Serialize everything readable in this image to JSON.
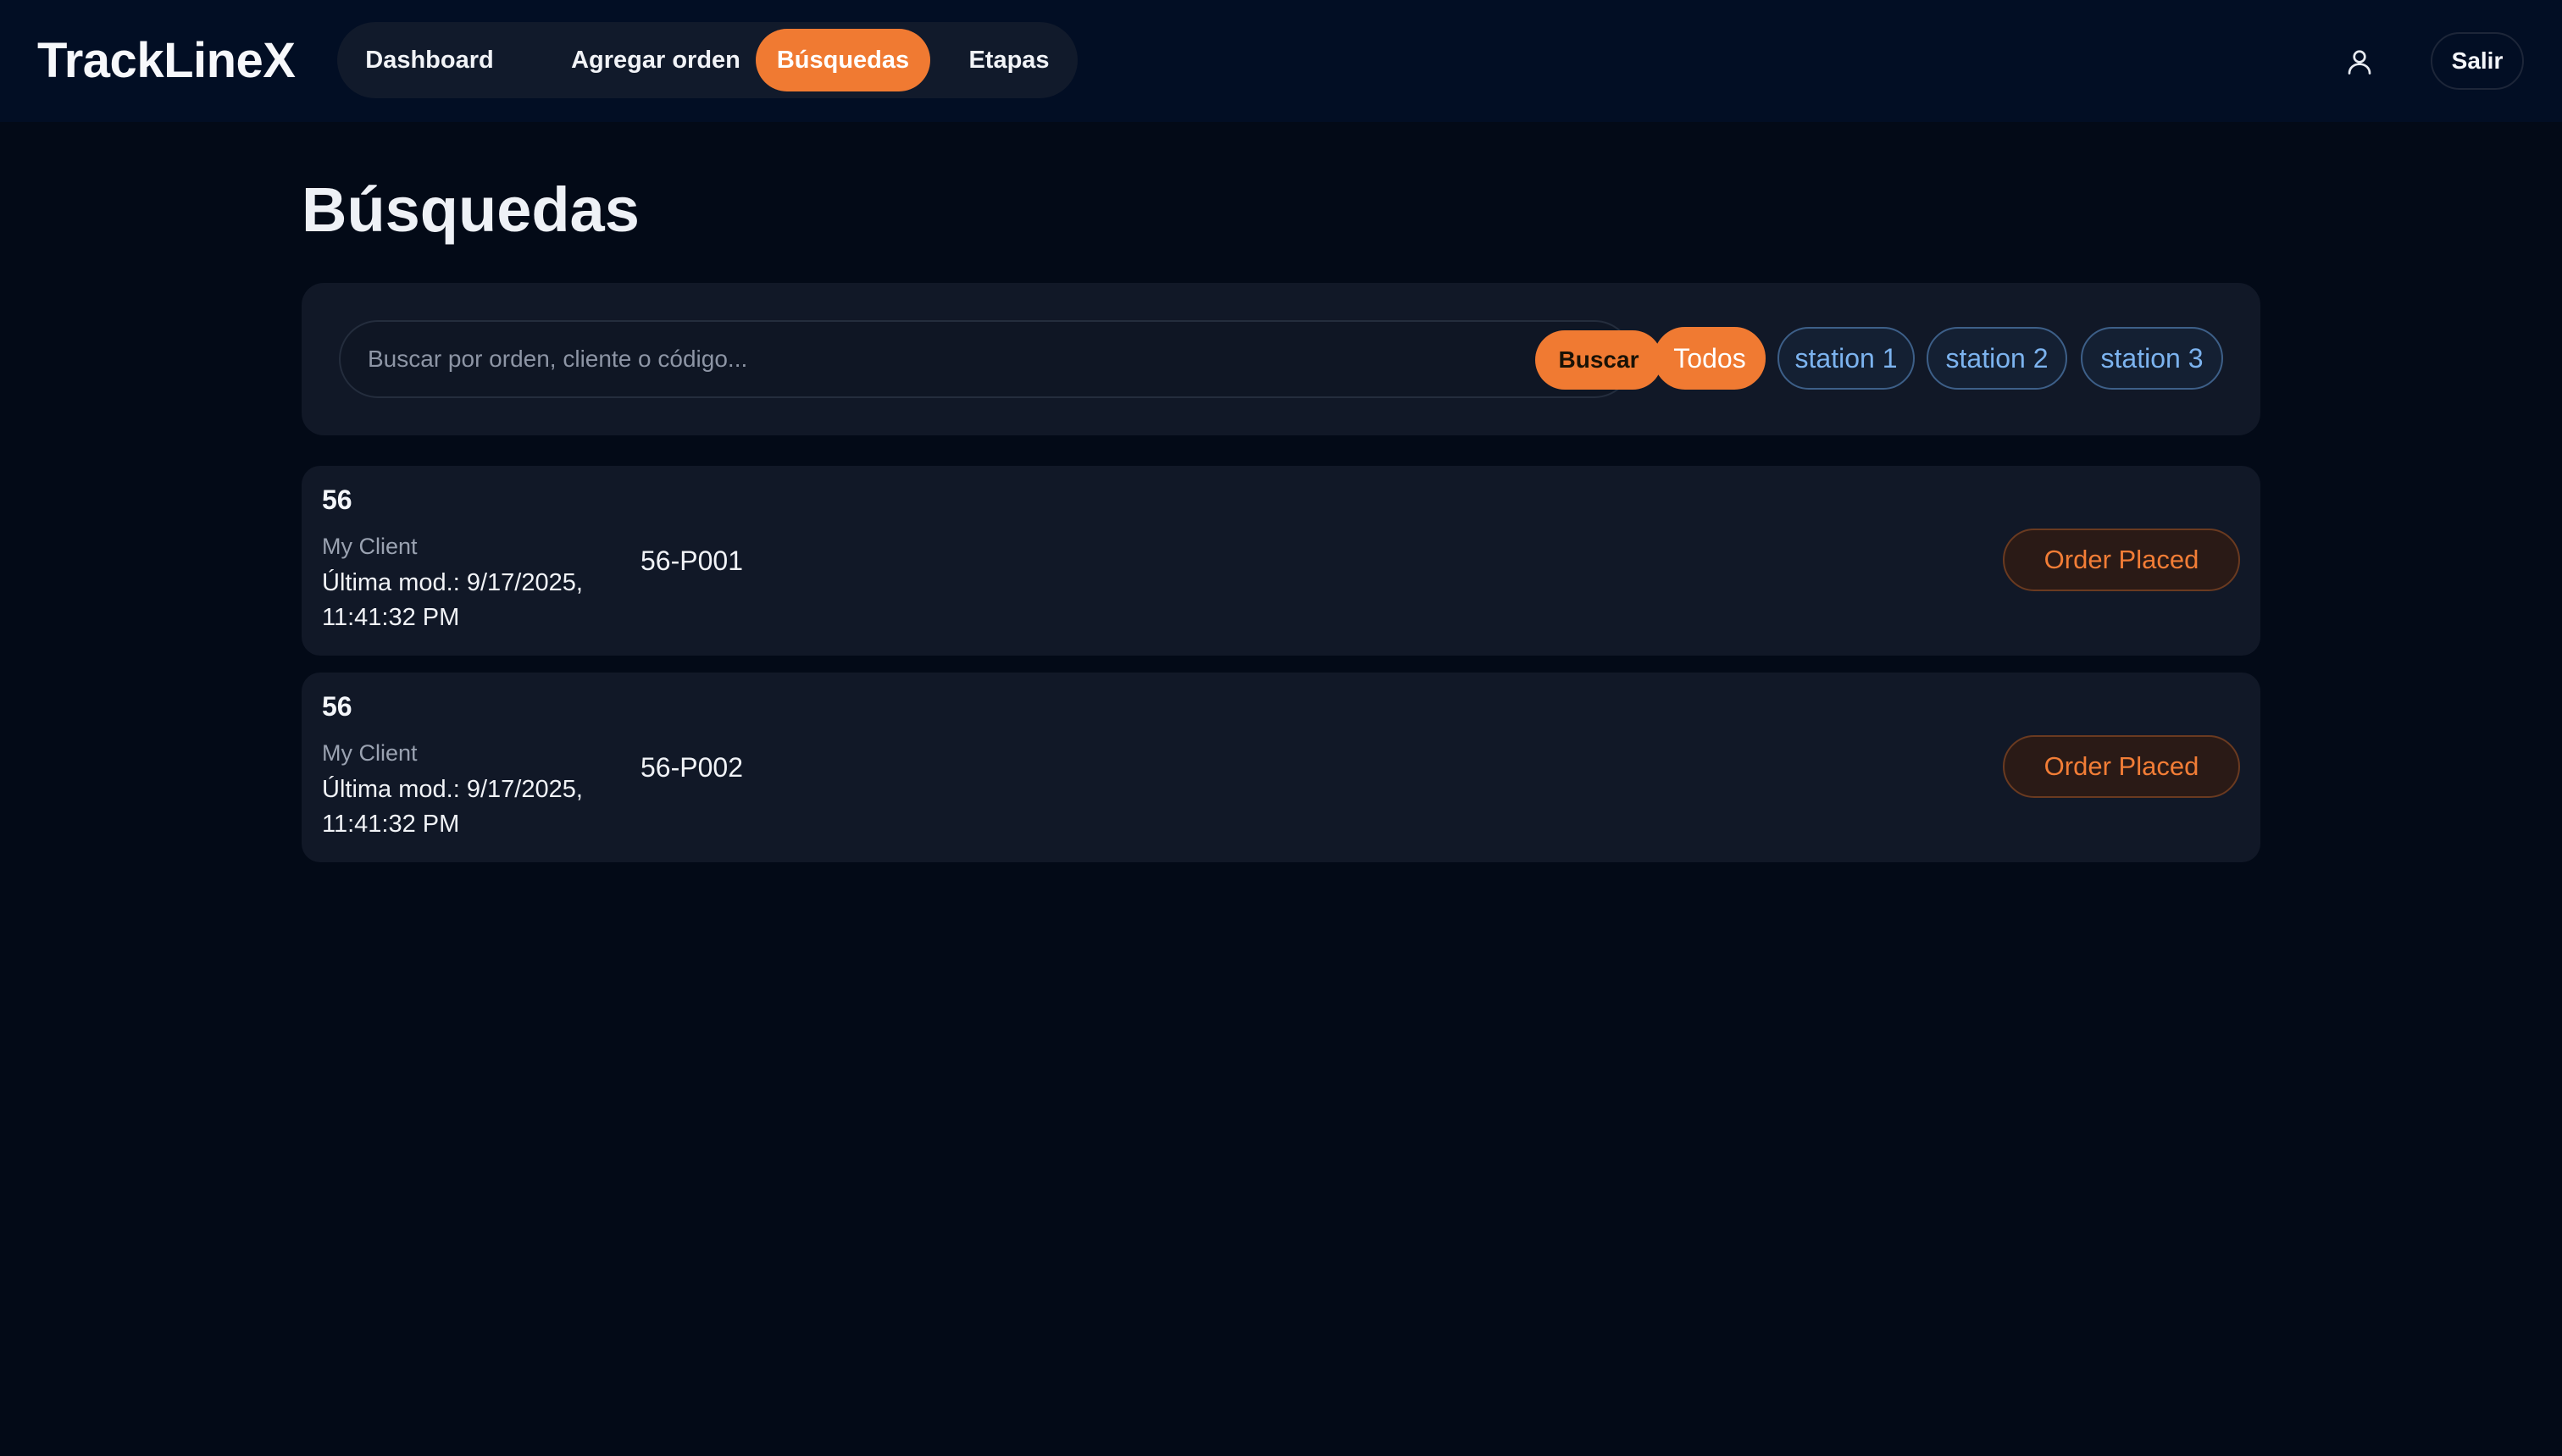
{
  "app": {
    "logo": "TrackLineX"
  },
  "nav": {
    "items": [
      {
        "label": "Dashboard",
        "active": false
      },
      {
        "label": "Agregar orden",
        "active": false
      },
      {
        "label": "Búsquedas",
        "active": true
      },
      {
        "label": "Etapas",
        "active": false
      }
    ]
  },
  "header": {
    "user_icon": "user-icon",
    "logout_label": "Salir"
  },
  "page": {
    "title": "Búsquedas"
  },
  "search": {
    "placeholder": "Buscar por orden, cliente o código...",
    "value": "",
    "button_label": "Buscar"
  },
  "filters": [
    {
      "label": "Todos",
      "active": true
    },
    {
      "label": "station 1",
      "active": false
    },
    {
      "label": "station 2",
      "active": false
    },
    {
      "label": "station 3",
      "active": false
    }
  ],
  "results": [
    {
      "order": "56",
      "client": "My Client",
      "modified": "Última mod.: 9/17/2025, 11:41:32 PM",
      "code": "56-P001",
      "status": "Order Placed"
    },
    {
      "order": "56",
      "client": "My Client",
      "modified": "Última mod.: 9/17/2025, 11:41:32 PM",
      "code": "56-P002",
      "status": "Order Placed"
    }
  ],
  "colors": {
    "background": "#030a17",
    "header": "#020e24",
    "panel": "#111827",
    "accent": "#f07a32",
    "chip_text": "#7cb3ef",
    "status_text": "#f27d36"
  }
}
